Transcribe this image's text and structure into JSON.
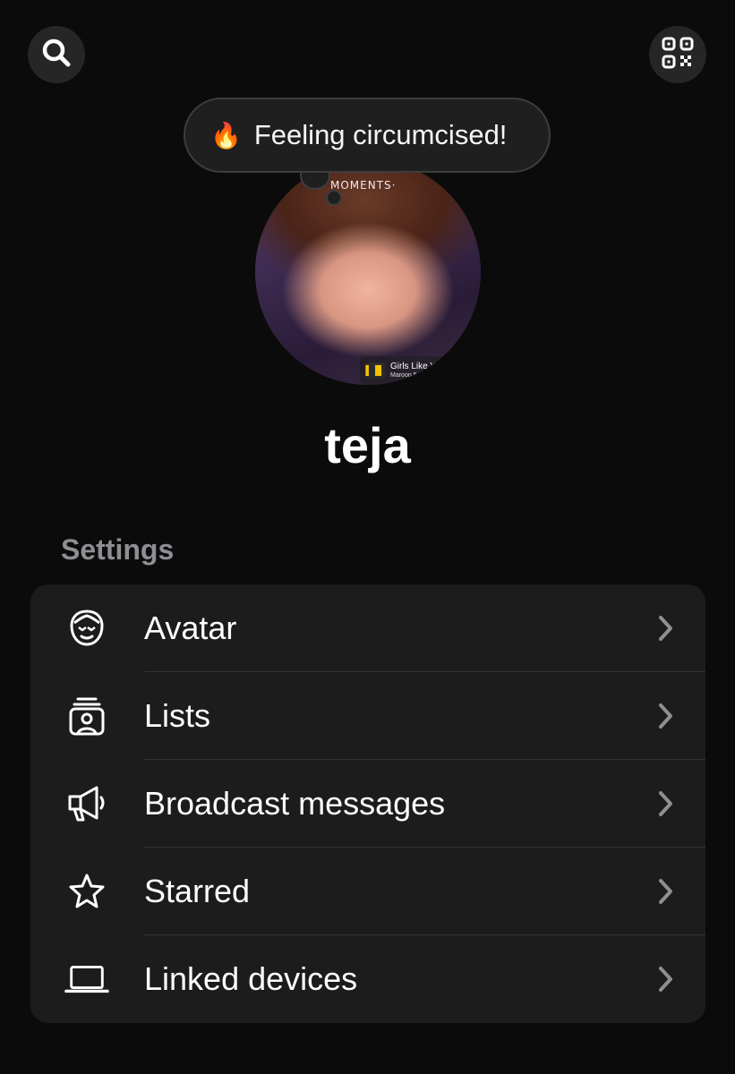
{
  "header": {
    "search_icon": "search-icon",
    "qr_icon": "qr-code-icon"
  },
  "status": {
    "emoji": "🔥",
    "text": "Feeling circumcised!"
  },
  "profile": {
    "avatar_overlay_text": "MOMENTS·",
    "music_title": "Girls Like You",
    "music_artist": "Maroon 5",
    "username": "teja"
  },
  "settings": {
    "section_label": "Settings",
    "items": [
      {
        "label": "Avatar",
        "icon": "avatar-face-icon"
      },
      {
        "label": "Lists",
        "icon": "lists-icon"
      },
      {
        "label": "Broadcast messages",
        "icon": "megaphone-icon"
      },
      {
        "label": "Starred",
        "icon": "star-icon"
      },
      {
        "label": "Linked devices",
        "icon": "laptop-icon"
      }
    ]
  },
  "colors": {
    "background": "#0b0b0b",
    "card": "#1c1c1c",
    "section_label": "#8e8e93",
    "chevron": "#8e8e93",
    "divider": "#333333"
  }
}
